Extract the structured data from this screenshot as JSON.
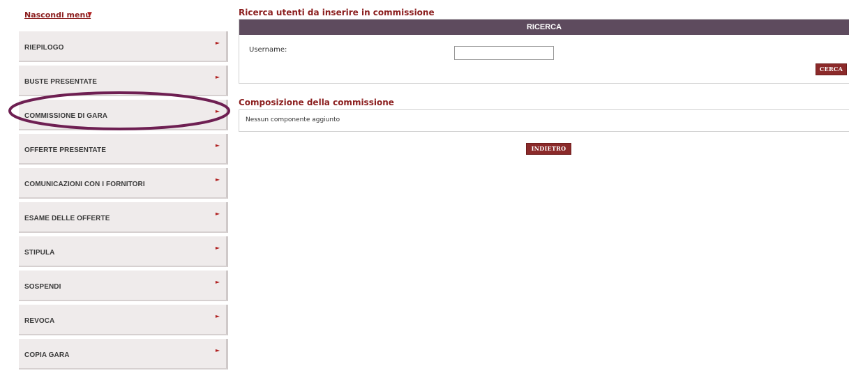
{
  "menu": {
    "hide_label": "Nascondi menu",
    "hide_arrow": "▼",
    "items": [
      {
        "label": "RIEPILOGO",
        "arrow": "►"
      },
      {
        "label": "BUSTE PRESENTATE",
        "arrow": "►"
      },
      {
        "label": "COMMISSIONE DI GARA",
        "arrow": "►"
      },
      {
        "label": "OFFERTE PRESENTATE",
        "arrow": "►"
      },
      {
        "label": "COMUNICAZIONI CON I FORNITORI",
        "arrow": "►"
      },
      {
        "label": "ESAME DELLE OFFERTE",
        "arrow": "►"
      },
      {
        "label": "STIPULA",
        "arrow": "►"
      },
      {
        "label": "SOSPENDI",
        "arrow": "►"
      },
      {
        "label": "REVOCA",
        "arrow": "►"
      },
      {
        "label": "COPIA GARA",
        "arrow": "►"
      }
    ],
    "highlighted_item": "COMMISSIONE DI GARA"
  },
  "search": {
    "title": "Ricerca utenti da inserire in commissione",
    "header": "RICERCA",
    "username_label": "Username:",
    "username_value": "",
    "search_button": "CERCA"
  },
  "composition": {
    "title": "Composizione della commissione",
    "empty_text": "Nessun componente aggiunto"
  },
  "actions": {
    "back_button": "INDIETRO"
  },
  "colors": {
    "accent": "#8b1e1e",
    "header_bg": "#5e4b5e",
    "button_bg": "#8b2a2a",
    "menu_bg": "#efebeb",
    "highlight_ellipse": "#6e1f52"
  }
}
